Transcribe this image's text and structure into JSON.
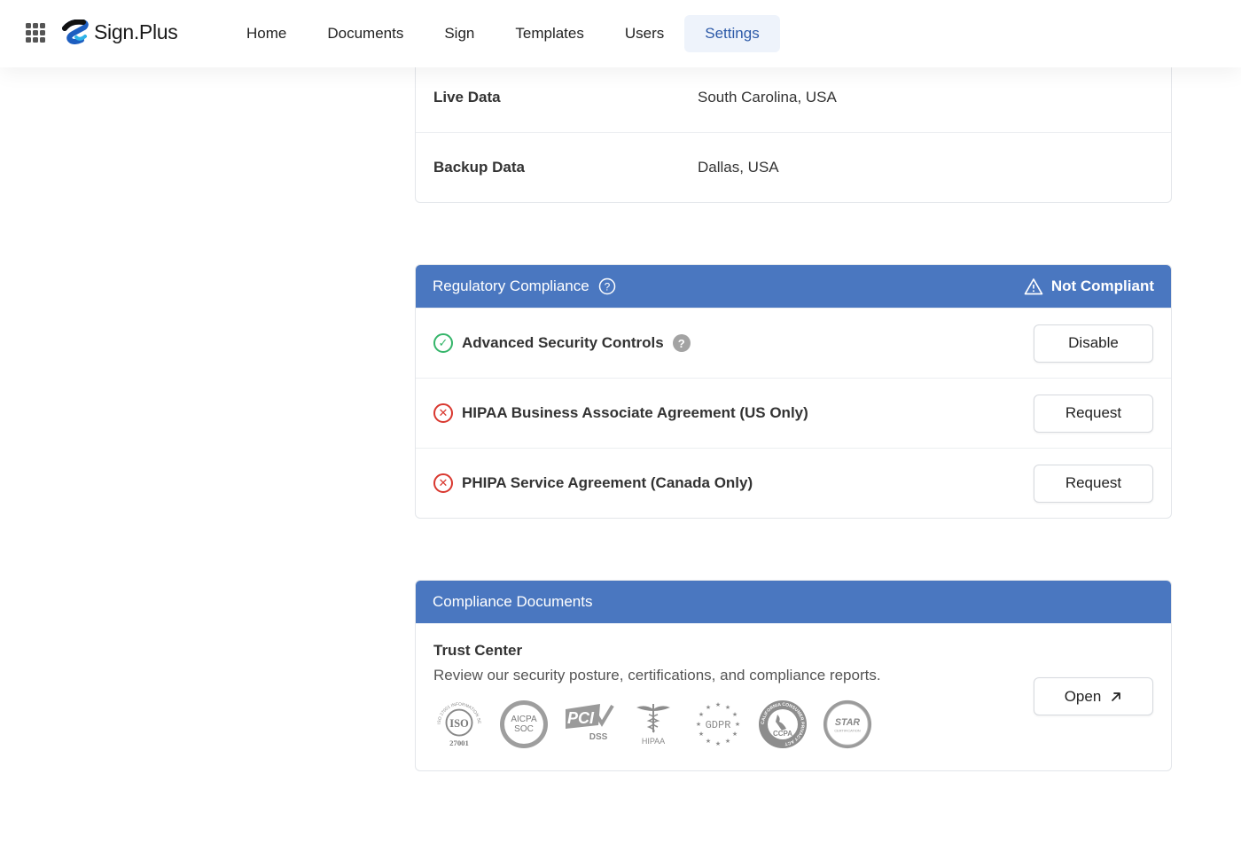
{
  "header": {
    "logo_text": "Sign.Plus",
    "nav": [
      {
        "label": "Home",
        "active": false
      },
      {
        "label": "Documents",
        "active": false
      },
      {
        "label": "Sign",
        "active": false
      },
      {
        "label": "Templates",
        "active": false
      },
      {
        "label": "Users",
        "active": false
      },
      {
        "label": "Settings",
        "active": true
      }
    ]
  },
  "data_location": {
    "rows": [
      {
        "label": "Live Data",
        "value": "South Carolina, USA"
      },
      {
        "label": "Backup Data",
        "value": "Dallas, USA"
      }
    ]
  },
  "regulatory": {
    "title": "Regulatory Compliance",
    "status": "Not Compliant",
    "items": [
      {
        "label": "Advanced Security Controls",
        "state": "ok",
        "button": "Disable"
      },
      {
        "label": "HIPAA Business Associate Agreement (US Only)",
        "state": "bad",
        "button": "Request"
      },
      {
        "label": "PHIPA Service Agreement (Canada Only)",
        "state": "bad",
        "button": "Request"
      }
    ]
  },
  "compliance_docs": {
    "title": "Compliance Documents",
    "trust_title": "Trust Center",
    "trust_desc": "Review our security posture, certifications, and compliance reports.",
    "open_label": "Open",
    "badges": {
      "iso_main": "ISO",
      "iso_num": "27001",
      "iso_ring": "ISO 27001 INFORMATION SECURITY",
      "aicpa_1": "AICPA",
      "aicpa_2": "SOC",
      "pci_1": "PCI",
      "pci_2": "DSS",
      "hipaa": "HIPAA",
      "gdpr": "GDPR",
      "ccpa": "CCPA",
      "ccpa_ring": "CALIFORNIA CONSUMER PRIVACY ACT",
      "star_1": "STAR",
      "star_2": "CERTIFICATION"
    }
  },
  "colors": {
    "accent": "#4a77c0",
    "ok": "#35b56a",
    "bad": "#d9382f"
  }
}
